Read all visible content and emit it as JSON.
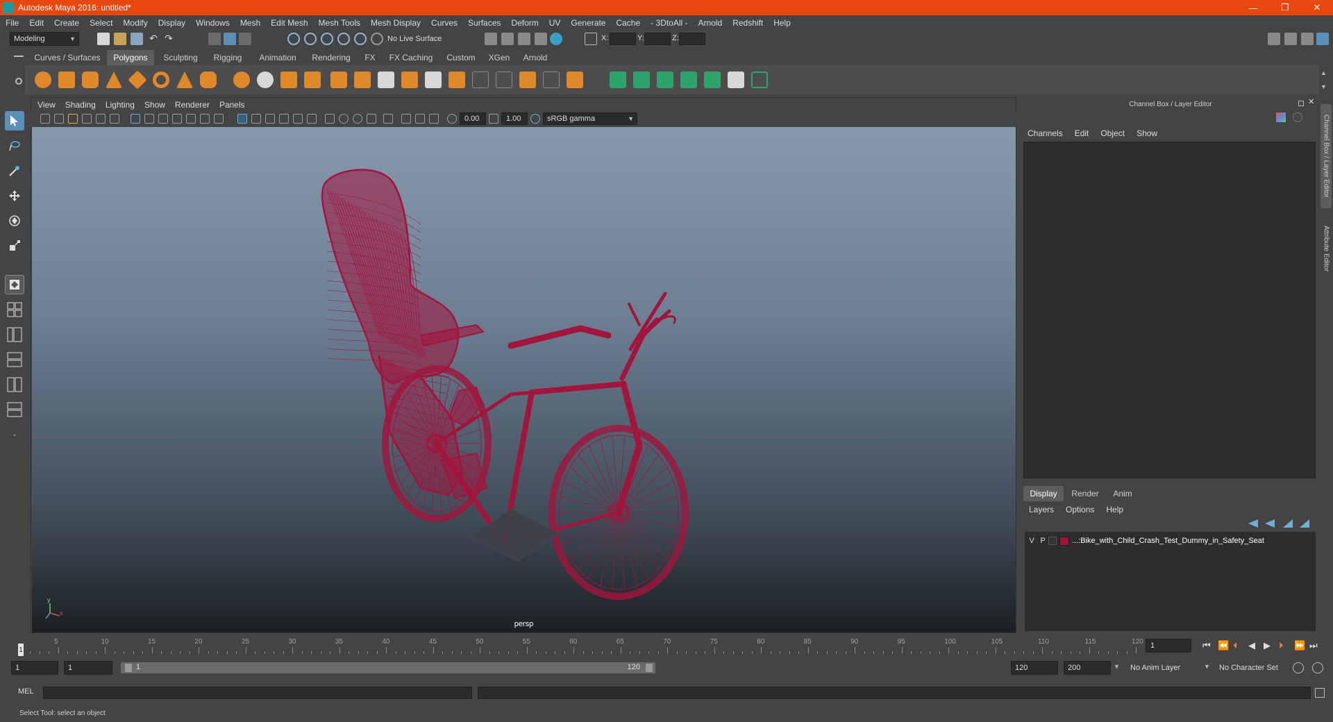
{
  "window": {
    "title": "Autodesk Maya 2016: untitled*",
    "controls": [
      "—",
      "❐",
      "✕"
    ]
  },
  "menubar": [
    "File",
    "Edit",
    "Create",
    "Select",
    "Modify",
    "Display",
    "Windows",
    "Mesh",
    "Edit Mesh",
    "Mesh Tools",
    "Mesh Display",
    "Curves",
    "Surfaces",
    "Deform",
    "UV",
    "Generate",
    "Cache",
    "- 3DtoAll -",
    "Arnold",
    "Redshift",
    "Help"
  ],
  "statusline": {
    "mode": "Modeling",
    "live_surface": "No Live Surface",
    "x_label": "X:",
    "y_label": "Y:",
    "z_label": "Z:"
  },
  "shelf_tabs": [
    "Curves / Surfaces",
    "Polygons",
    "Sculpting",
    "Rigging",
    "Animation",
    "Rendering",
    "FX",
    "FX Caching",
    "Custom",
    "XGen",
    "Arnold"
  ],
  "active_shelf_tab": "Polygons",
  "viewport": {
    "menu": [
      "View",
      "Shading",
      "Lighting",
      "Show",
      "Renderer",
      "Panels"
    ],
    "exposure": "0.00",
    "gamma": "1.00",
    "color_space": "sRGB gamma",
    "camera_label": "persp",
    "axis_y": "y",
    "axis_x": "x",
    "wire_color": "#a3143d"
  },
  "channel_box": {
    "header": "Channel Box / Layer Editor",
    "menu": [
      "Channels",
      "Edit",
      "Object",
      "Show"
    ]
  },
  "layer_editor": {
    "tabs": [
      "Display",
      "Render",
      "Anim"
    ],
    "active_tab": "Display",
    "menu": [
      "Layers",
      "Options",
      "Help"
    ],
    "layers": [
      {
        "v": "V",
        "p": "P",
        "name": "...:Bike_with_Child_Crash_Test_Dummy_in_Safety_Seat",
        "color": "#a3143d"
      }
    ]
  },
  "side_tabs": [
    "Channel Box / Layer Editor",
    "Attribute Editor"
  ],
  "timeline": {
    "ticks": [
      "1",
      "5",
      "10",
      "15",
      "20",
      "25",
      "30",
      "35",
      "40",
      "45",
      "50",
      "55",
      "60",
      "65",
      "70",
      "75",
      "80",
      "85",
      "90",
      "95",
      "100",
      "105",
      "110",
      "115",
      "120"
    ],
    "current_frame": "1"
  },
  "range": {
    "start": "1",
    "playback_start": "1",
    "bar_start": "1",
    "bar_end": "120",
    "playback_end": "120",
    "end": "200",
    "anim_layer": "No Anim Layer",
    "character_set": "No Character Set"
  },
  "command_line": {
    "label": "MEL"
  },
  "help_line": "Select Tool: select an object"
}
